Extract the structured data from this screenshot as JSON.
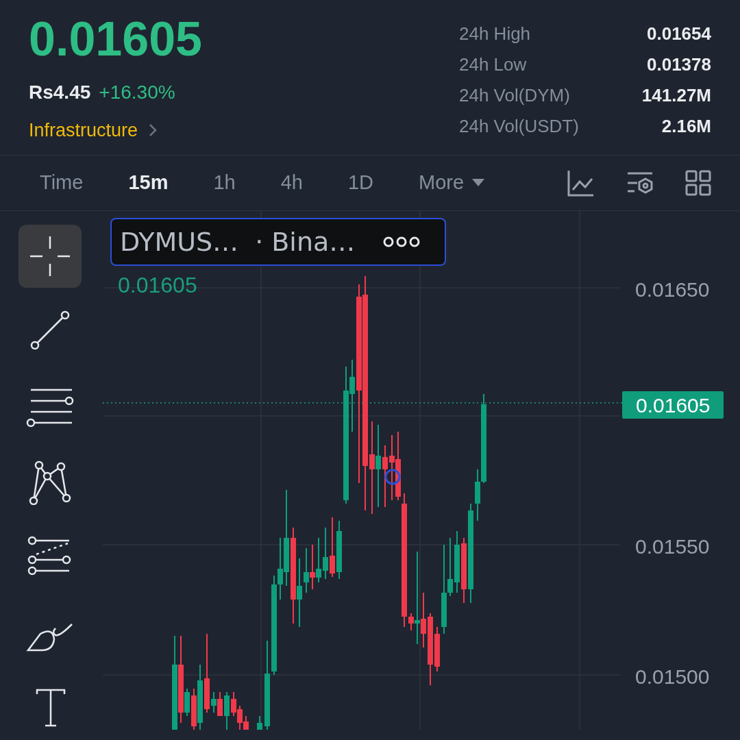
{
  "price": "0.01605",
  "fiat_price": "Rs4.45",
  "change": "+16.30%",
  "category": "Infrastructure",
  "stats": [
    {
      "label": "24h High",
      "value": "0.01654"
    },
    {
      "label": "24h Low",
      "value": "0.01378"
    },
    {
      "label": "24h Vol(DYM)",
      "value": "141.27M"
    },
    {
      "label": "24h Vol(USDT)",
      "value": "2.16M"
    }
  ],
  "intervals": [
    {
      "label": "Time",
      "selected": false,
      "kind": "plain"
    },
    {
      "label": "15m",
      "selected": true,
      "kind": "plain"
    },
    {
      "label": "1h",
      "selected": false,
      "kind": "plain"
    },
    {
      "label": "4h",
      "selected": false,
      "kind": "plain"
    },
    {
      "label": "1D",
      "selected": false,
      "kind": "plain"
    },
    {
      "label": "More",
      "selected": false,
      "kind": "dropdown"
    }
  ],
  "drawing_tools": [
    {
      "kind": "crosshair",
      "selected": true
    },
    {
      "kind": "trend-line",
      "selected": false
    },
    {
      "kind": "parallel-lines",
      "selected": false
    },
    {
      "kind": "pattern",
      "selected": false
    },
    {
      "kind": "fib",
      "selected": false
    },
    {
      "kind": "brush",
      "selected": false
    },
    {
      "kind": "text",
      "selected": false
    }
  ],
  "legend": {
    "symbol": "DYMUS…",
    "exchange": "· Bina…",
    "price": "0.01605"
  },
  "price_axis": [
    "0.01650",
    "0.01550",
    "0.01500"
  ],
  "last_price_badge": "0.01605"
}
